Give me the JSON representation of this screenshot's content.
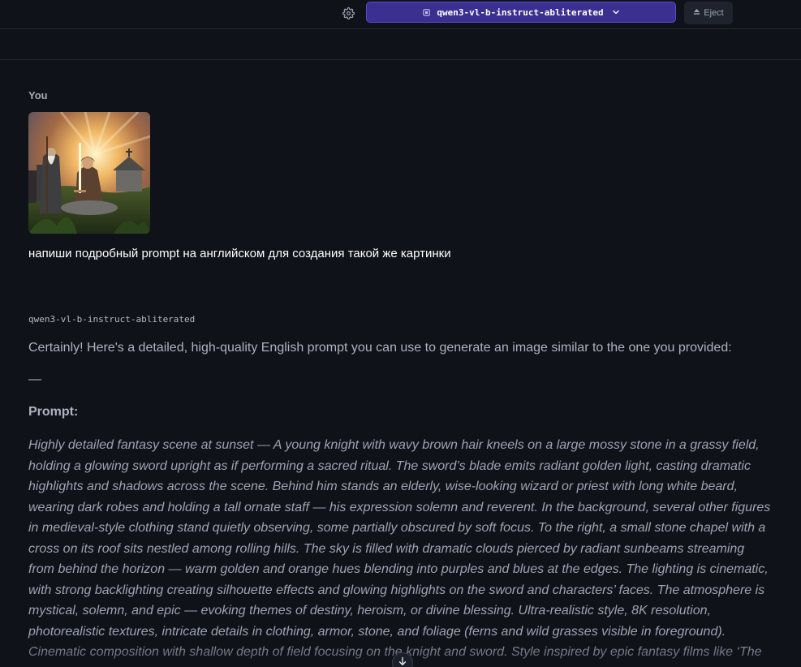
{
  "header": {
    "model_name": "qwen3-vl-b-instruct-abliterated",
    "eject_label": "Eject",
    "icons": [
      "gear-icon",
      "chip-icon",
      "chevron-down-icon",
      "eject-icon"
    ]
  },
  "user_message": {
    "sender": "You",
    "text": "напиши подробный prompt на английском для создания такой же картинки",
    "attachment_icon": "image-thumbnail"
  },
  "assistant_message": {
    "sender": "qwen3-vl-b-instruct-abliterated",
    "intro": "Certainly! Here's a detailed, high-quality English prompt you can use to generate an image similar to the one you provided:",
    "separator": "—",
    "prompt_heading": "Prompt:",
    "prompt_text": "Highly detailed fantasy scene at sunset — A young knight with wavy brown hair kneels on a large mossy stone in a grassy field, holding a glowing sword upright as if performing a sacred ritual. The sword’s blade emits radiant golden light, casting dramatic highlights and shadows across the scene. Behind him stands an elderly, wise-looking wizard or priest with long white beard, wearing dark robes and holding a tall ornate staff — his expression solemn and reverent. In the background, several other figures in medieval-style clothing stand quietly observing, some partially obscured by soft focus. To the right, a small stone chapel with a cross on its roof sits nestled among rolling hills. The sky is filled with dramatic clouds pierced by radiant sunbeams streaming from behind the horizon — warm golden and orange hues blending into purples and blues at the edges. The lighting is cinematic, with strong backlighting creating silhouette effects and glowing highlights on the sword and characters’ faces. The atmosphere is mystical, solemn, and epic — evoking themes of destiny, heroism, or divine blessing. Ultra-realistic style, 8K resolution, photorealistic textures, intricate details in clothing, armor, stone, and foliage (ferns and wild grasses visible in foreground). Cinematic composition with shallow depth of field focusing on the knight and sword. Style inspired by epic fantasy films like ‘The Lord of the Rings’ or ‘Game of"
  },
  "controls": {
    "scroll_down_icon": "arrow-down-icon"
  }
}
